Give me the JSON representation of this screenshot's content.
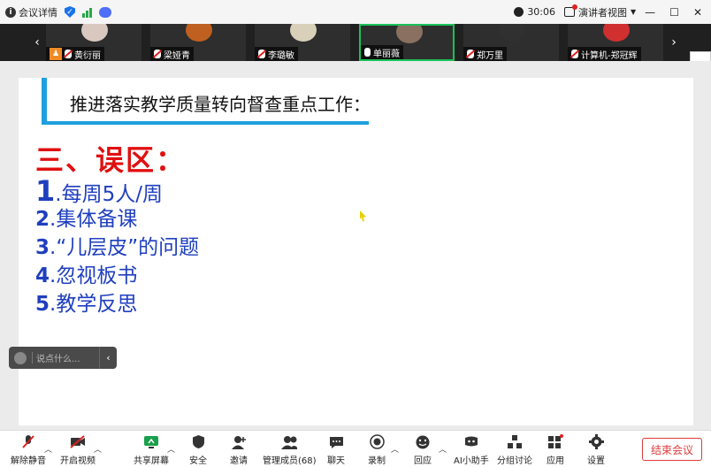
{
  "topbar": {
    "meeting_details": "会议详情",
    "time": "30:06",
    "presenter_view": "演讲者视图",
    "minimize": "—",
    "maximize": "☐",
    "close": "✕"
  },
  "participants": [
    {
      "name": "黄衍丽",
      "mic": "host"
    },
    {
      "name": "梁娅青",
      "mic": "muted"
    },
    {
      "name": "李璐敏",
      "mic": "muted"
    },
    {
      "name": "单丽薇",
      "mic": "on"
    },
    {
      "name": "郑万里",
      "mic": "muted"
    },
    {
      "name": "计算机-郑冠辉",
      "mic": "muted"
    }
  ],
  "slide": {
    "title": "推进落实教学质量转向督查重点工作：",
    "heading": "三、误区：",
    "items": [
      {
        "num": "1",
        "text": ".每周5人/周"
      },
      {
        "num": "2",
        "text": ".集体备课"
      },
      {
        "num": "3",
        "text": ".“儿层皮”的问题"
      },
      {
        "num": "4",
        "text": ".忽视板书"
      },
      {
        "num": "5",
        "text": ".教学反思"
      }
    ]
  },
  "chat": {
    "placeholder": "说点什么..."
  },
  "toolbar": {
    "unmute": "解除静音",
    "start_video": "开启视频",
    "share_screen": "共享屏幕",
    "security": "安全",
    "invite": "邀请",
    "manage_members": "管理成员(68)",
    "chat": "聊天",
    "record": "录制",
    "reactions": "回应",
    "ai_assistant": "AI小助手",
    "breakout": "分组讨论",
    "apps": "应用",
    "settings": "设置",
    "end_meeting": "结束会议"
  },
  "colors": {
    "accent": "#1ea0e0",
    "heading_red": "#e01010",
    "item_blue": "#1f3fbf",
    "end_red": "#e03a3a",
    "active_green": "#19c25a"
  }
}
